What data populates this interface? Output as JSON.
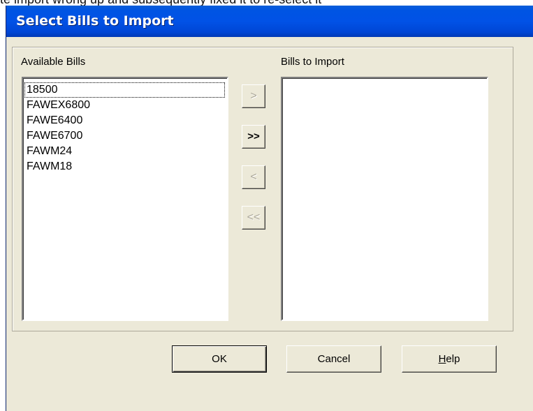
{
  "background_fragment": "te import wrong up and subsequently fixed it to re-select it",
  "dialog": {
    "title": "Select Bills to Import"
  },
  "available": {
    "label": "Available Bills",
    "items": [
      "18500",
      "FAWEX6800",
      "FAWE6400",
      "FAWE6700",
      "FAWM24",
      "FAWM18"
    ],
    "focused_index": 0
  },
  "to_import": {
    "label": "Bills to Import",
    "items": []
  },
  "move_buttons": {
    "add_one": ">",
    "add_all": ">>",
    "remove_one": "<",
    "remove_all": "<<"
  },
  "footer": {
    "ok": "OK",
    "cancel": "Cancel",
    "help_mnemonic": "H",
    "help_rest": "elp"
  },
  "colors": {
    "dialog_face": "#ECE9D8",
    "titlebar": "#0054E3",
    "disabled_text": "#ACA899"
  }
}
